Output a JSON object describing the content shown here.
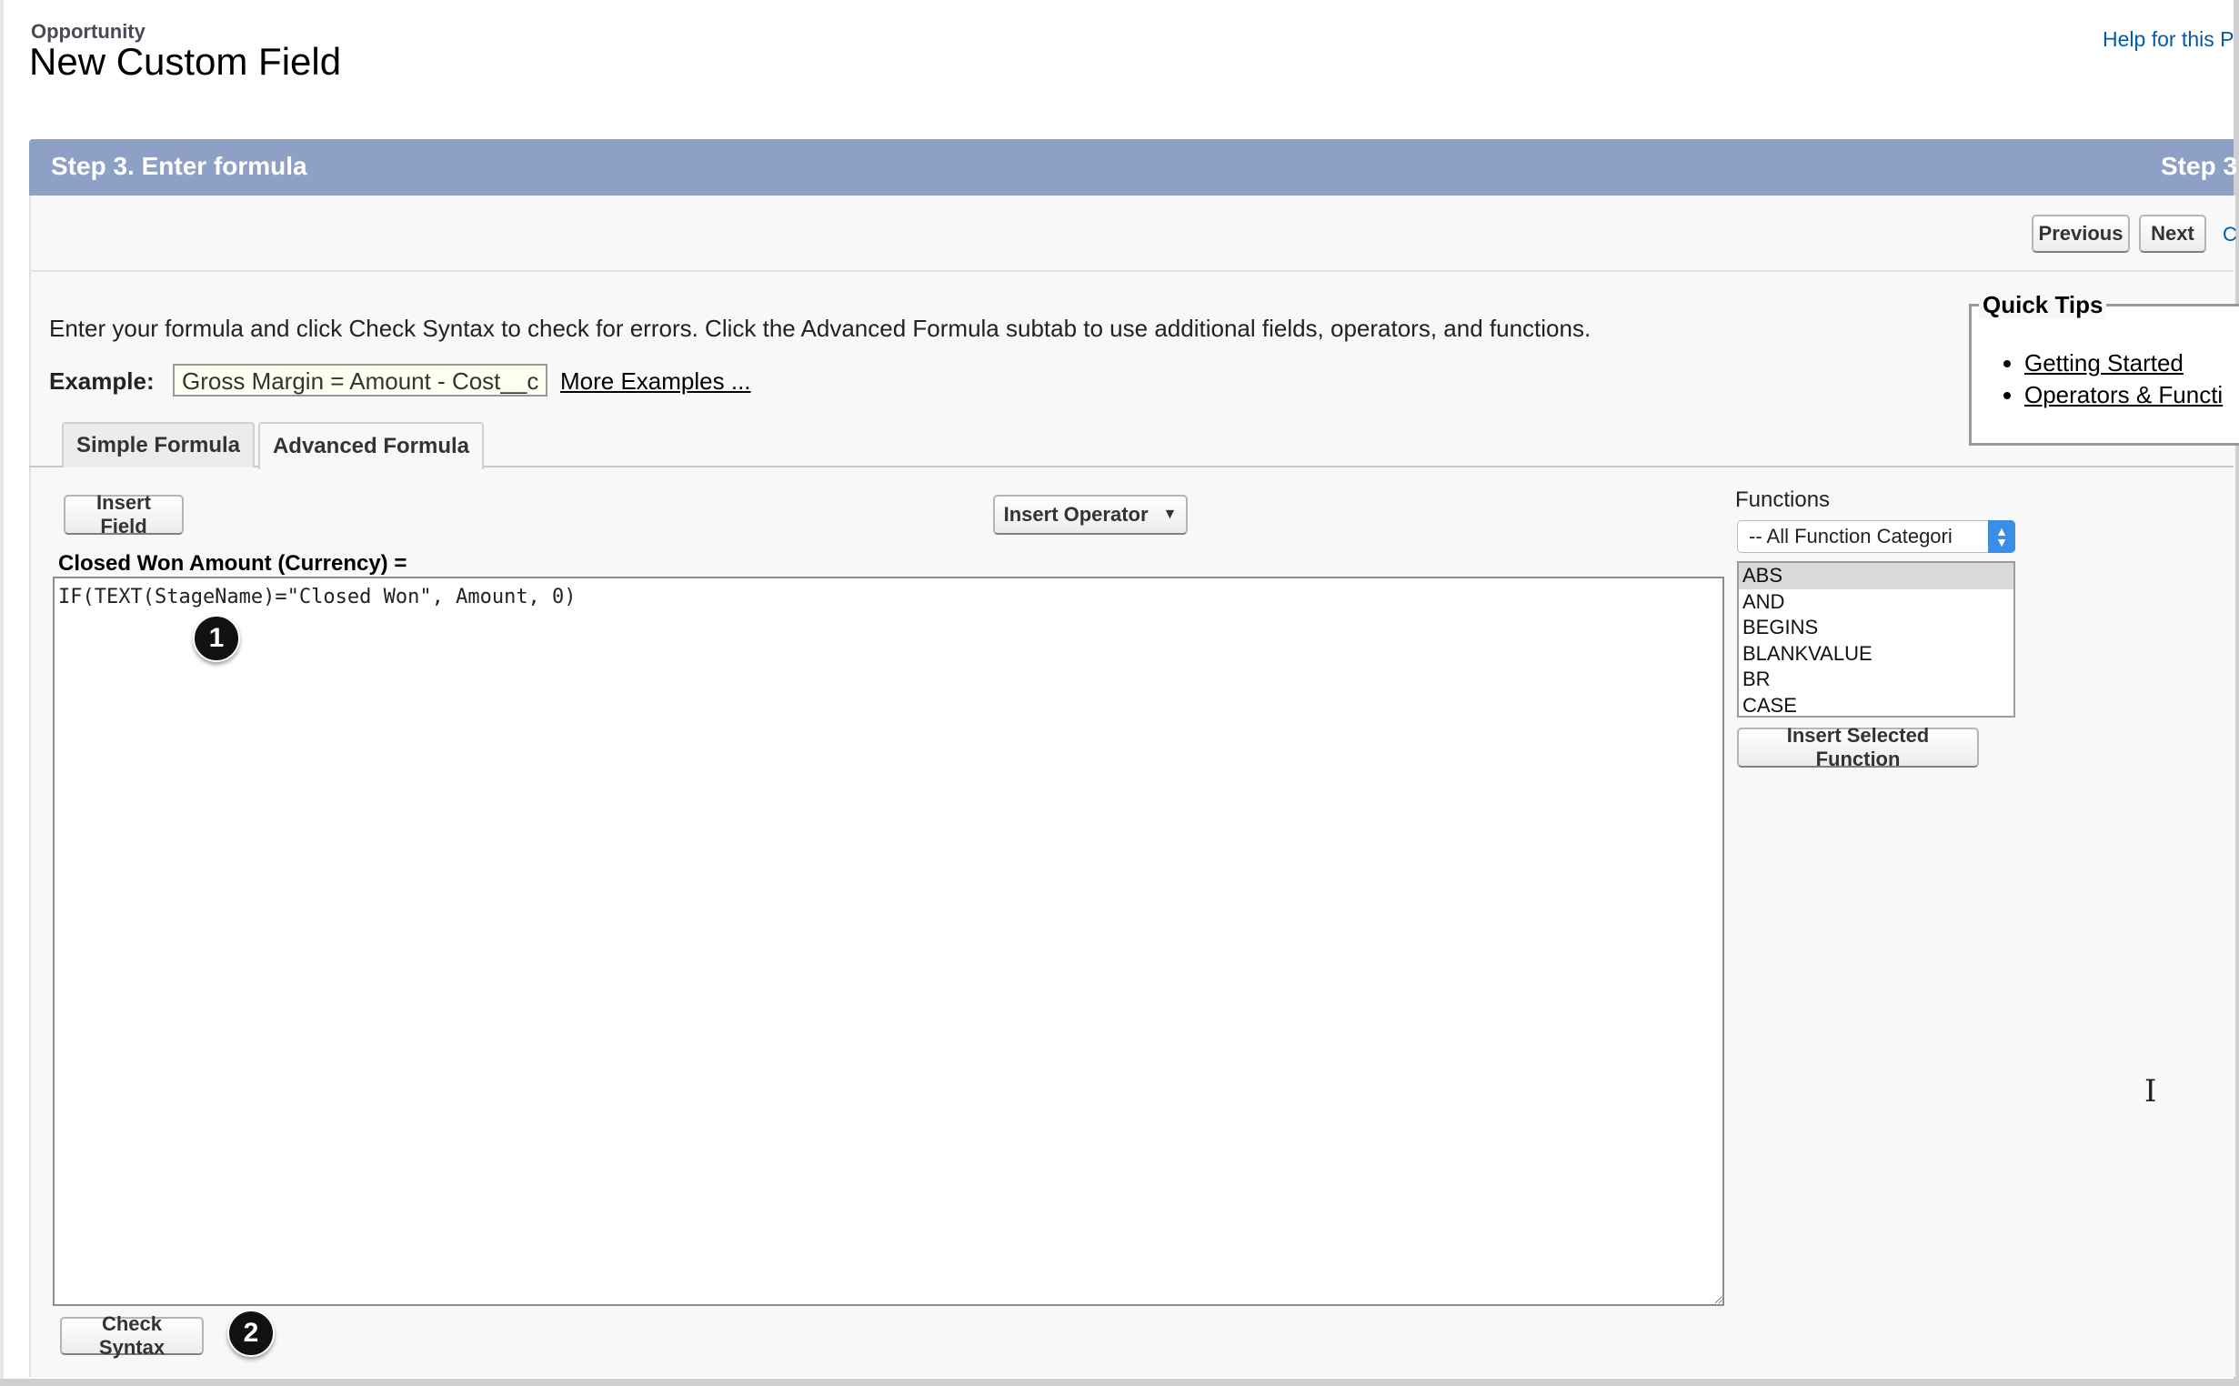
{
  "header": {
    "object_name": "Opportunity",
    "title": "New Custom Field",
    "help_link": "Help for this P"
  },
  "step_bar": {
    "title": "Step 3. Enter formula",
    "step_indicator": "Step 3"
  },
  "buttons": {
    "previous": "Previous",
    "next": "Next",
    "cancel_clipped": "C",
    "insert_field": "Insert Field",
    "insert_operator": "Insert Operator",
    "check_syntax": "Check Syntax",
    "insert_selected_function": "Insert Selected Function"
  },
  "instructions": "Enter your formula and click Check Syntax to check for errors. Click the Advanced Formula subtab to use additional fields, operators, and functions.",
  "example": {
    "label": "Example:",
    "value": "Gross Margin = Amount - Cost__c",
    "more_examples": "More Examples ..."
  },
  "quick_tips": {
    "title": "Quick Tips",
    "links": [
      "Getting Started",
      "Operators & Functi"
    ]
  },
  "tabs": [
    {
      "label": "Simple Formula",
      "active": false
    },
    {
      "label": "Advanced Formula",
      "active": true
    }
  ],
  "formula": {
    "field_label": "Closed Won Amount (Currency) =",
    "value": "IF(TEXT(StageName)=\"Closed Won\", Amount, 0)"
  },
  "functions": {
    "label": "Functions",
    "category_selected": "-- All Function Categori",
    "items": [
      "ABS",
      "AND",
      "BEGINS",
      "BLANKVALUE",
      "BR",
      "CASE"
    ],
    "selected_item": "ABS"
  },
  "callouts": [
    "1",
    "2"
  ],
  "colors": {
    "step_bar": "#8ea0c5",
    "link": "#015ba7",
    "select_accent": "#3b8de6"
  },
  "icons": [
    "dropdown-caret-icon",
    "select-arrows-icon",
    "resize-grip-icon",
    "text-cursor-icon"
  ]
}
